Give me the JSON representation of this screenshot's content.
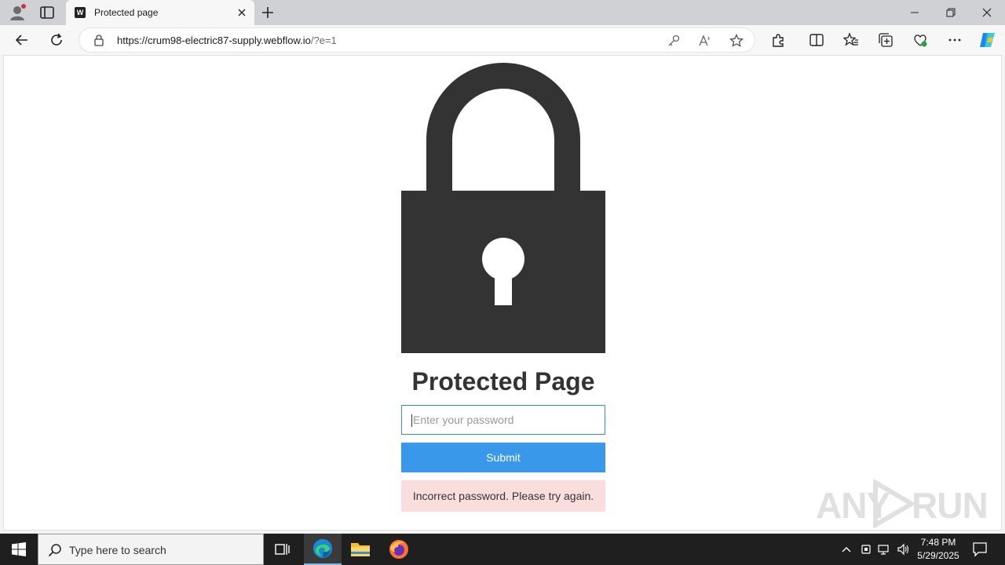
{
  "browser": {
    "tab_title": "Protected page",
    "favicon_letter": "W",
    "url_host": "https://crum98-electric87-supply.webflow.io",
    "url_path": "/?e=1"
  },
  "page": {
    "heading": "Protected Page",
    "password_placeholder": "Enter your password",
    "submit_label": "Submit",
    "error_message": "Incorrect password. Please try again.",
    "lock_color": "#333333",
    "submit_color": "#3a98eb",
    "error_bg": "#fadede"
  },
  "watermark": {
    "left": "ANY",
    "right": "RUN"
  },
  "taskbar": {
    "search_placeholder": "Type here to search",
    "time": "7:48 PM",
    "date": "5/29/2025"
  }
}
